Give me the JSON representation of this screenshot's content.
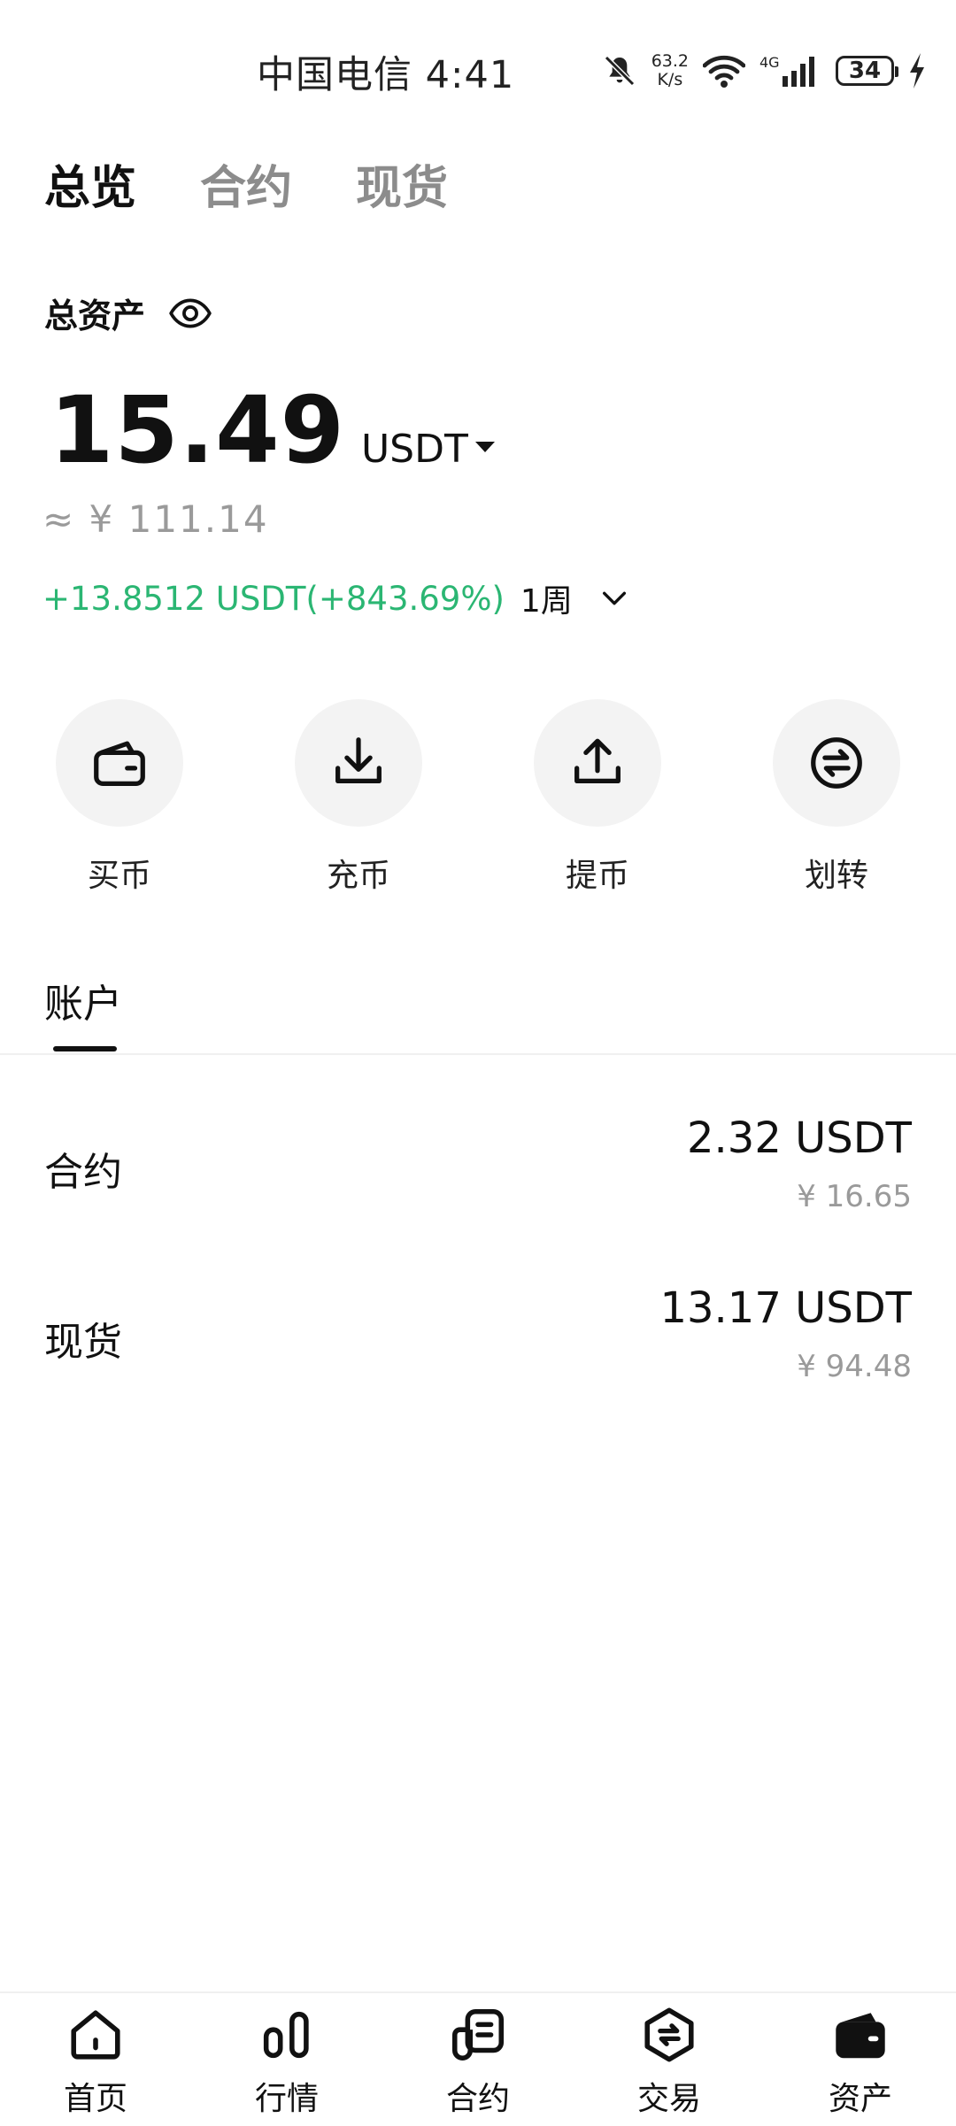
{
  "status_bar": {
    "time": "中国电信 4:41",
    "net_speed_value": "63.2",
    "net_speed_unit": "K/s",
    "network_type": "4G",
    "battery": "34"
  },
  "top_tabs": [
    {
      "label": "总览",
      "active": true
    },
    {
      "label": "合约",
      "active": false
    },
    {
      "label": "现货",
      "active": false
    }
  ],
  "overview": {
    "total_label": "总资产",
    "amount": "15.49",
    "currency": "USDT",
    "approx_cny": "≈ ¥ 111.14",
    "pnl": "+13.8512 USDT(+843.69%)",
    "period": "1周",
    "pnl_color": "#2bb673"
  },
  "actions": [
    {
      "label": "买币",
      "icon": "wallet-icon"
    },
    {
      "label": "充币",
      "icon": "download-icon"
    },
    {
      "label": "提币",
      "icon": "upload-icon"
    },
    {
      "label": "划转",
      "icon": "transfer-icon"
    }
  ],
  "accounts_section": {
    "tab_label": "账户",
    "rows": [
      {
        "name": "合约",
        "amount": "2.32 USDT",
        "cny": "¥ 16.65"
      },
      {
        "name": "现货",
        "amount": "13.17 USDT",
        "cny": "¥ 94.48"
      }
    ]
  },
  "bottom_nav": [
    {
      "label": "首页",
      "icon": "home-icon"
    },
    {
      "label": "行情",
      "icon": "market-icon"
    },
    {
      "label": "合约",
      "icon": "futures-icon"
    },
    {
      "label": "交易",
      "icon": "trade-icon"
    },
    {
      "label": "资产",
      "icon": "assets-wallet-icon",
      "active": true
    }
  ]
}
